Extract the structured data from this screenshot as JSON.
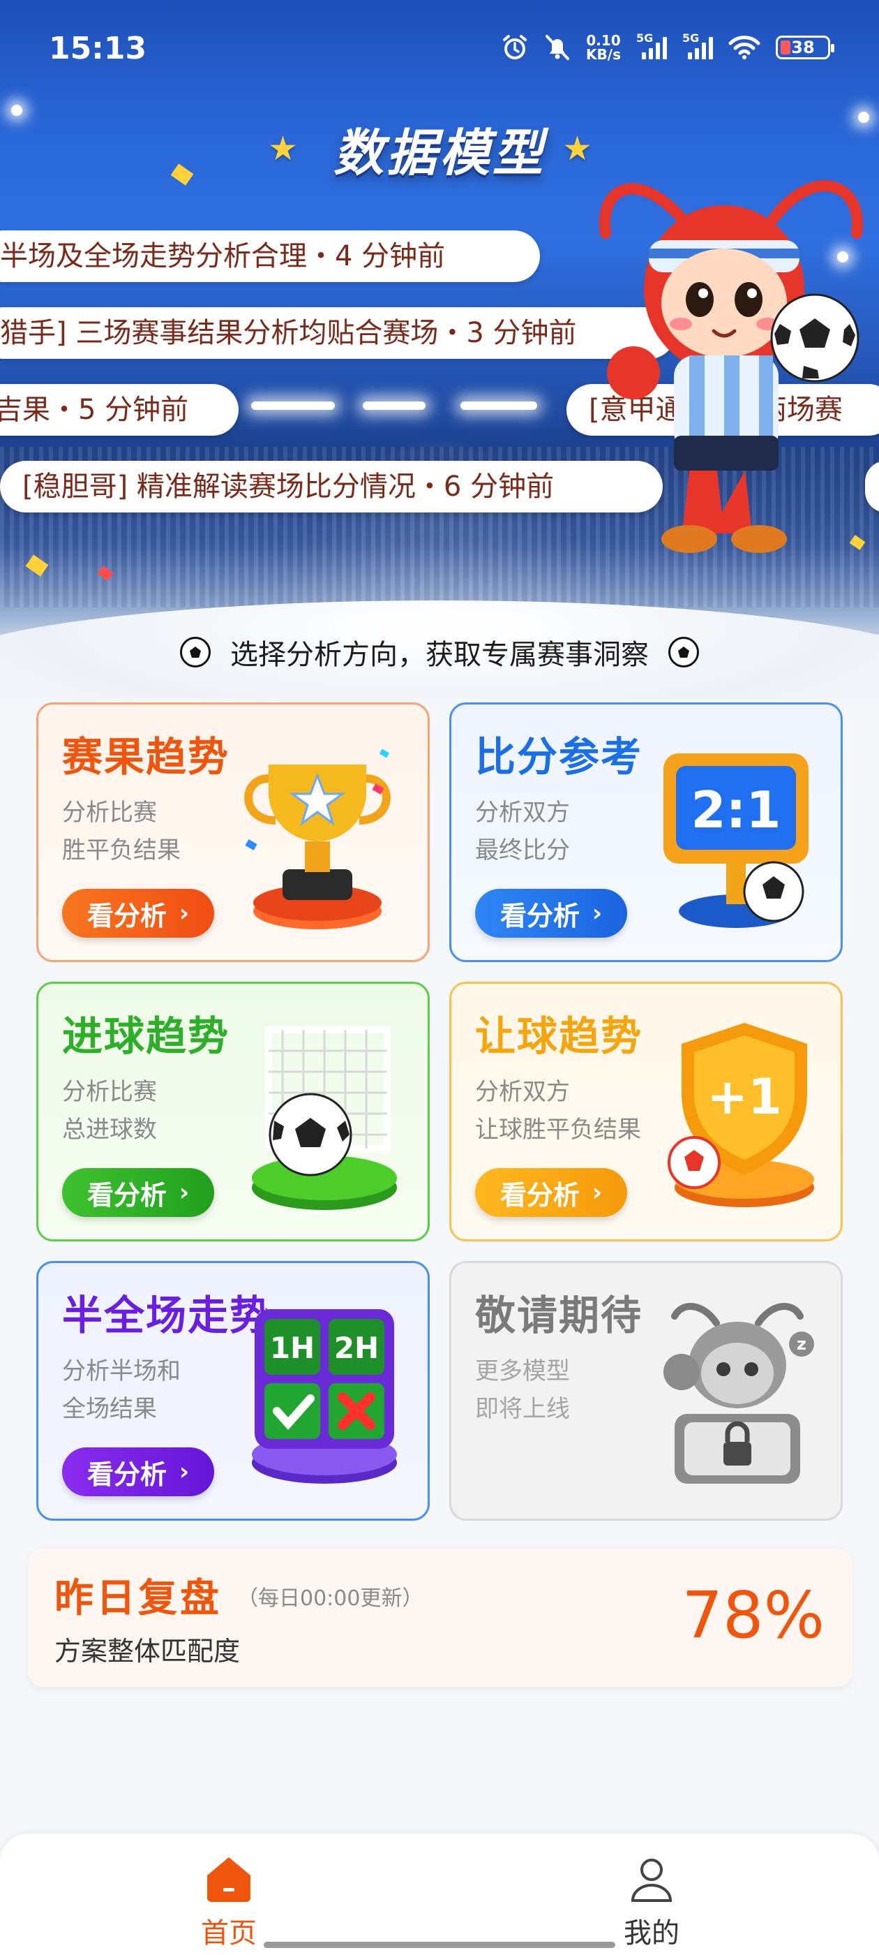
{
  "status_bar": {
    "time": "15:13",
    "net_speed_value": "0.10",
    "net_speed_unit": "KB/s",
    "signal1_tag": "5G",
    "signal2_tag": "5G",
    "battery_level": "38"
  },
  "header": {
    "title": "数据模型"
  },
  "tickers": [
    "半场及全场走势分析合理・4 分钟前",
    "猎手] 三场赛事结果分析均贴合赛场・3 分钟前",
    "吉果・5 分钟前",
    "[意甲通] 连续两场赛",
    "[稳胆哥] 精准解读赛场比分情况・6 分钟前"
  ],
  "subtitle": "选择分析方向，获取专属赛事洞察",
  "cards": [
    {
      "title": "赛果趋势",
      "desc1": "分析比赛",
      "desc2": "胜平负结果",
      "button": "看分析",
      "accent": "#f0550e"
    },
    {
      "title": "比分参考",
      "desc1": "分析双方",
      "desc2": "最终比分",
      "button": "看分析",
      "accent": "#1b6fe6"
    },
    {
      "title": "进球趋势",
      "desc1": "分析比赛",
      "desc2": "总进球数",
      "button": "看分析",
      "accent": "#2fae29"
    },
    {
      "title": "让球趋势",
      "desc1": "分析双方",
      "desc2": "让球胜平负结果",
      "button": "看分析",
      "accent": "#f5a510"
    },
    {
      "title": "半全场走势",
      "desc1": "分析半场和",
      "desc2": "全场结果",
      "button": "看分析",
      "accent": "#6a1fe0"
    },
    {
      "title": "敬请期待",
      "desc1": "更多模型",
      "desc2": "即将上线",
      "button": "",
      "accent": "#8a8a8a"
    }
  ],
  "art_text": {
    "score": "2:1",
    "plus_one": "+1",
    "first_half": "1H",
    "second_half": "2H",
    "zzz": "z"
  },
  "review": {
    "title": "昨日复盘",
    "note": "（每日00:00更新）",
    "subtitle": "方案整体匹配度",
    "percent": "78%"
  },
  "tabbar": {
    "home_label": "首页",
    "mine_label": "我的"
  }
}
